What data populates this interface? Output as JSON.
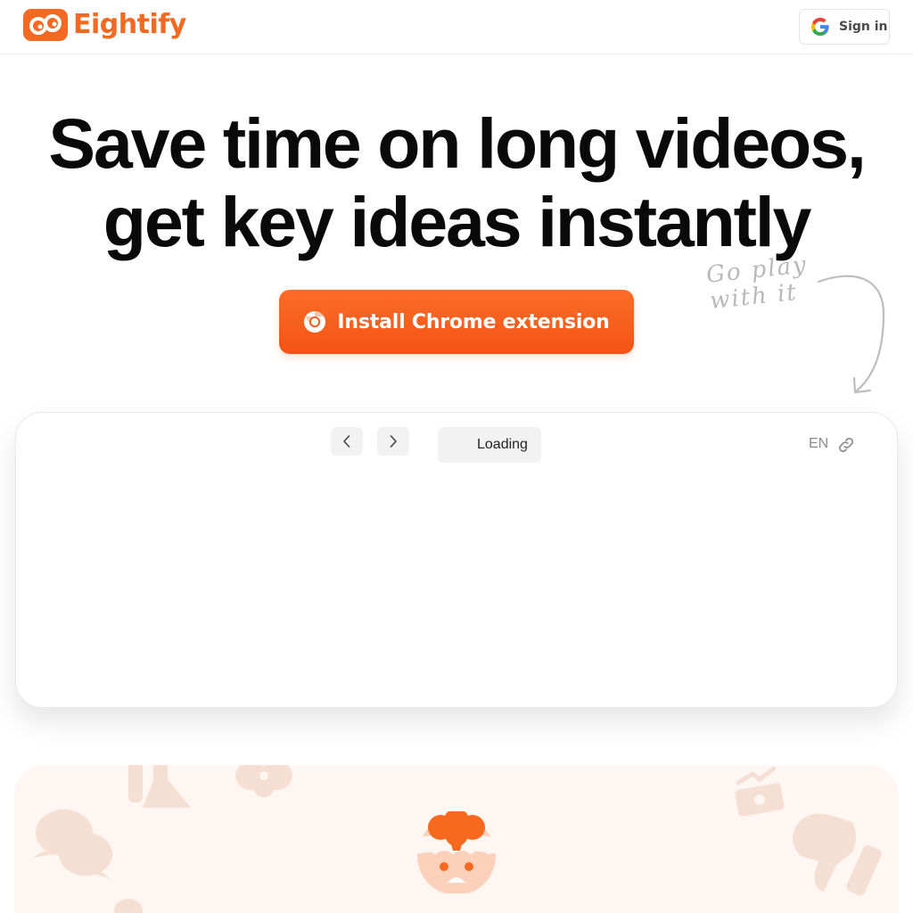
{
  "header": {
    "brand": "Eightify",
    "signin_label": "Sign in",
    "brand_color": "#f26a21"
  },
  "hero": {
    "title_line1": "Save time on long videos,",
    "title_line2": "get key ideas instantly",
    "cta_label": "Install Chrome extension",
    "cta_color": "#f55315",
    "hint_line1": "Go play",
    "hint_line2": "with it"
  },
  "widget": {
    "prev_icon": "chevron-left-icon",
    "next_icon": "chevron-right-icon",
    "status": "Loading",
    "language": "EN",
    "link_icon": "link-icon"
  },
  "lower": {
    "icons": [
      "chat-bubbles-icon",
      "flask-icon",
      "brain-icon",
      "money-growth-icon",
      "thumbs-down-icon",
      "mascot-icon"
    ]
  }
}
